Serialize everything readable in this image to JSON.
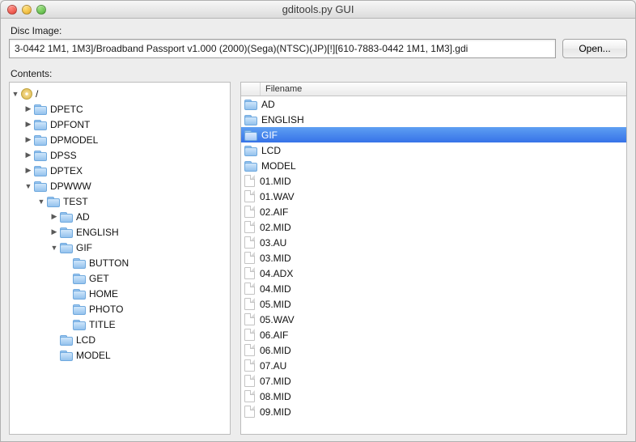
{
  "window": {
    "title": "gditools.py GUI"
  },
  "disc_image": {
    "label": "Disc Image:",
    "value": "3-0442 1M1, 1M3]/Broadband Passport v1.000 (2000)(Sega)(NTSC)(JP)[!][610-7883-0442 1M1, 1M3].gdi",
    "open_label": "Open..."
  },
  "contents": {
    "label": "Contents:",
    "tree_root": "/",
    "tree": [
      {
        "label": "DPETC",
        "type": "folder",
        "expanded": false
      },
      {
        "label": "DPFONT",
        "type": "folder",
        "expanded": false
      },
      {
        "label": "DPMODEL",
        "type": "folder",
        "expanded": false
      },
      {
        "label": "DPSS",
        "type": "folder",
        "expanded": false
      },
      {
        "label": "DPTEX",
        "type": "folder",
        "expanded": false
      },
      {
        "label": "DPWWW",
        "type": "folder",
        "expanded": true,
        "children": [
          {
            "label": "TEST",
            "type": "folder",
            "expanded": true,
            "children": [
              {
                "label": "AD",
                "type": "folder",
                "expanded": false
              },
              {
                "label": "ENGLISH",
                "type": "folder",
                "expanded": false
              },
              {
                "label": "GIF",
                "type": "folder",
                "expanded": true,
                "children": [
                  {
                    "label": "BUTTON",
                    "type": "folder",
                    "leaf": true
                  },
                  {
                    "label": "GET",
                    "type": "folder",
                    "leaf": true
                  },
                  {
                    "label": "HOME",
                    "type": "folder",
                    "leaf": true
                  },
                  {
                    "label": "PHOTO",
                    "type": "folder",
                    "leaf": true
                  },
                  {
                    "label": "TITLE",
                    "type": "folder",
                    "leaf": true
                  }
                ]
              },
              {
                "label": "LCD",
                "type": "folder",
                "leaf": true
              },
              {
                "label": "MODEL",
                "type": "folder",
                "leaf": true
              }
            ]
          }
        ]
      }
    ]
  },
  "file_list": {
    "header": "Filename",
    "items": [
      {
        "label": "AD",
        "type": "folder"
      },
      {
        "label": "ENGLISH",
        "type": "folder"
      },
      {
        "label": "GIF",
        "type": "folder",
        "selected": true
      },
      {
        "label": "LCD",
        "type": "folder"
      },
      {
        "label": "MODEL",
        "type": "folder"
      },
      {
        "label": "01.MID",
        "type": "file"
      },
      {
        "label": "01.WAV",
        "type": "file"
      },
      {
        "label": "02.AIF",
        "type": "file"
      },
      {
        "label": "02.MID",
        "type": "file"
      },
      {
        "label": "03.AU",
        "type": "file"
      },
      {
        "label": "03.MID",
        "type": "file"
      },
      {
        "label": "04.ADX",
        "type": "file"
      },
      {
        "label": "04.MID",
        "type": "file"
      },
      {
        "label": "05.MID",
        "type": "file"
      },
      {
        "label": "05.WAV",
        "type": "file"
      },
      {
        "label": "06.AIF",
        "type": "file"
      },
      {
        "label": "06.MID",
        "type": "file"
      },
      {
        "label": "07.AU",
        "type": "file"
      },
      {
        "label": "07.MID",
        "type": "file"
      },
      {
        "label": "08.MID",
        "type": "file"
      },
      {
        "label": "09.MID",
        "type": "file"
      }
    ]
  }
}
